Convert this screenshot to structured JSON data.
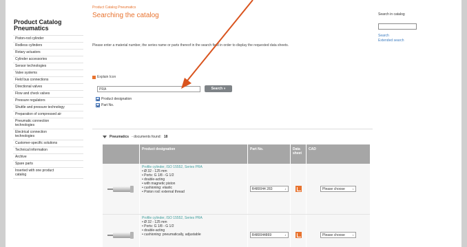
{
  "sidebar": {
    "title_line1": "Product Catalog",
    "title_line2": "Pneumatics",
    "items": [
      "Piston-rod cylinder",
      "Rodless cylinders",
      "Rotary actuators",
      "Cylinder accessories",
      "Sensor technologies",
      "Valve systems",
      "Field bus connections",
      "Directional valves",
      "Flow and check valves",
      "Pressure regulators",
      "Shuttle and pressure technology",
      "Preparation of compressed air",
      "Pneumatic connection\ntechnologies",
      "Electrical connection\ntechnologies",
      "Customer-specific solutions",
      "Technical information",
      "Archive",
      "Spare parts",
      "Inserted with one product\ncatalog"
    ]
  },
  "header": {
    "breadcrumb": "Product Catalog Pneumatics",
    "title": "Searching the catalog"
  },
  "intro": "Please enter a material number, the series name or parts thereof in the search field in order to display the requested data sheets.",
  "explain_link": "Explain Icon",
  "search": {
    "value": "PRA",
    "button": "Search »"
  },
  "checks": {
    "product_designation": "Product designation",
    "part_no": "Part No."
  },
  "result": {
    "label": "Pneumatics",
    "found_text": "- documents found:",
    "count": "18"
  },
  "table": {
    "headers": {
      "designation": "Product designation",
      "part_no": "Part No.",
      "data_sheet": "Data sheet",
      "cad": "CAD"
    },
    "rows": [
      {
        "link": "Profile cylinder, ISO 15552, Series PRA",
        "desc": "• Ø 32 - 125 mm\n• Ports: G 1/8 - G 1/2\n• double-acting\n• with magnetic piston\n• cushioning: elastic\n• Piston rod: external thread",
        "part_no": "R480044 283",
        "cad": "Please choose"
      },
      {
        "link": "Profile cylinder, ISO 15552, Series PRA",
        "desc": "• Ø 32 - 125 mm\n• Ports: G 1/8 - G 1/2\n• double-acting\n• cushioning: pneumatically, adjustable",
        "part_no": "R480044869",
        "cad": "Please choose"
      }
    ]
  },
  "right_panel": {
    "label": "Search in catalog",
    "links": [
      "Search",
      "Extended search"
    ]
  },
  "colors": {
    "accent": "#e8732f",
    "link": "#3d9d9b",
    "header_bg": "#a6a6a6",
    "annotation_arrow": "#d9541e"
  },
  "icons": [
    "checkbox-checked-icon",
    "dropdown-arrow-icon",
    "pdf-icon",
    "collapse-triangle-icon",
    "annotation-arrow-icon"
  ]
}
